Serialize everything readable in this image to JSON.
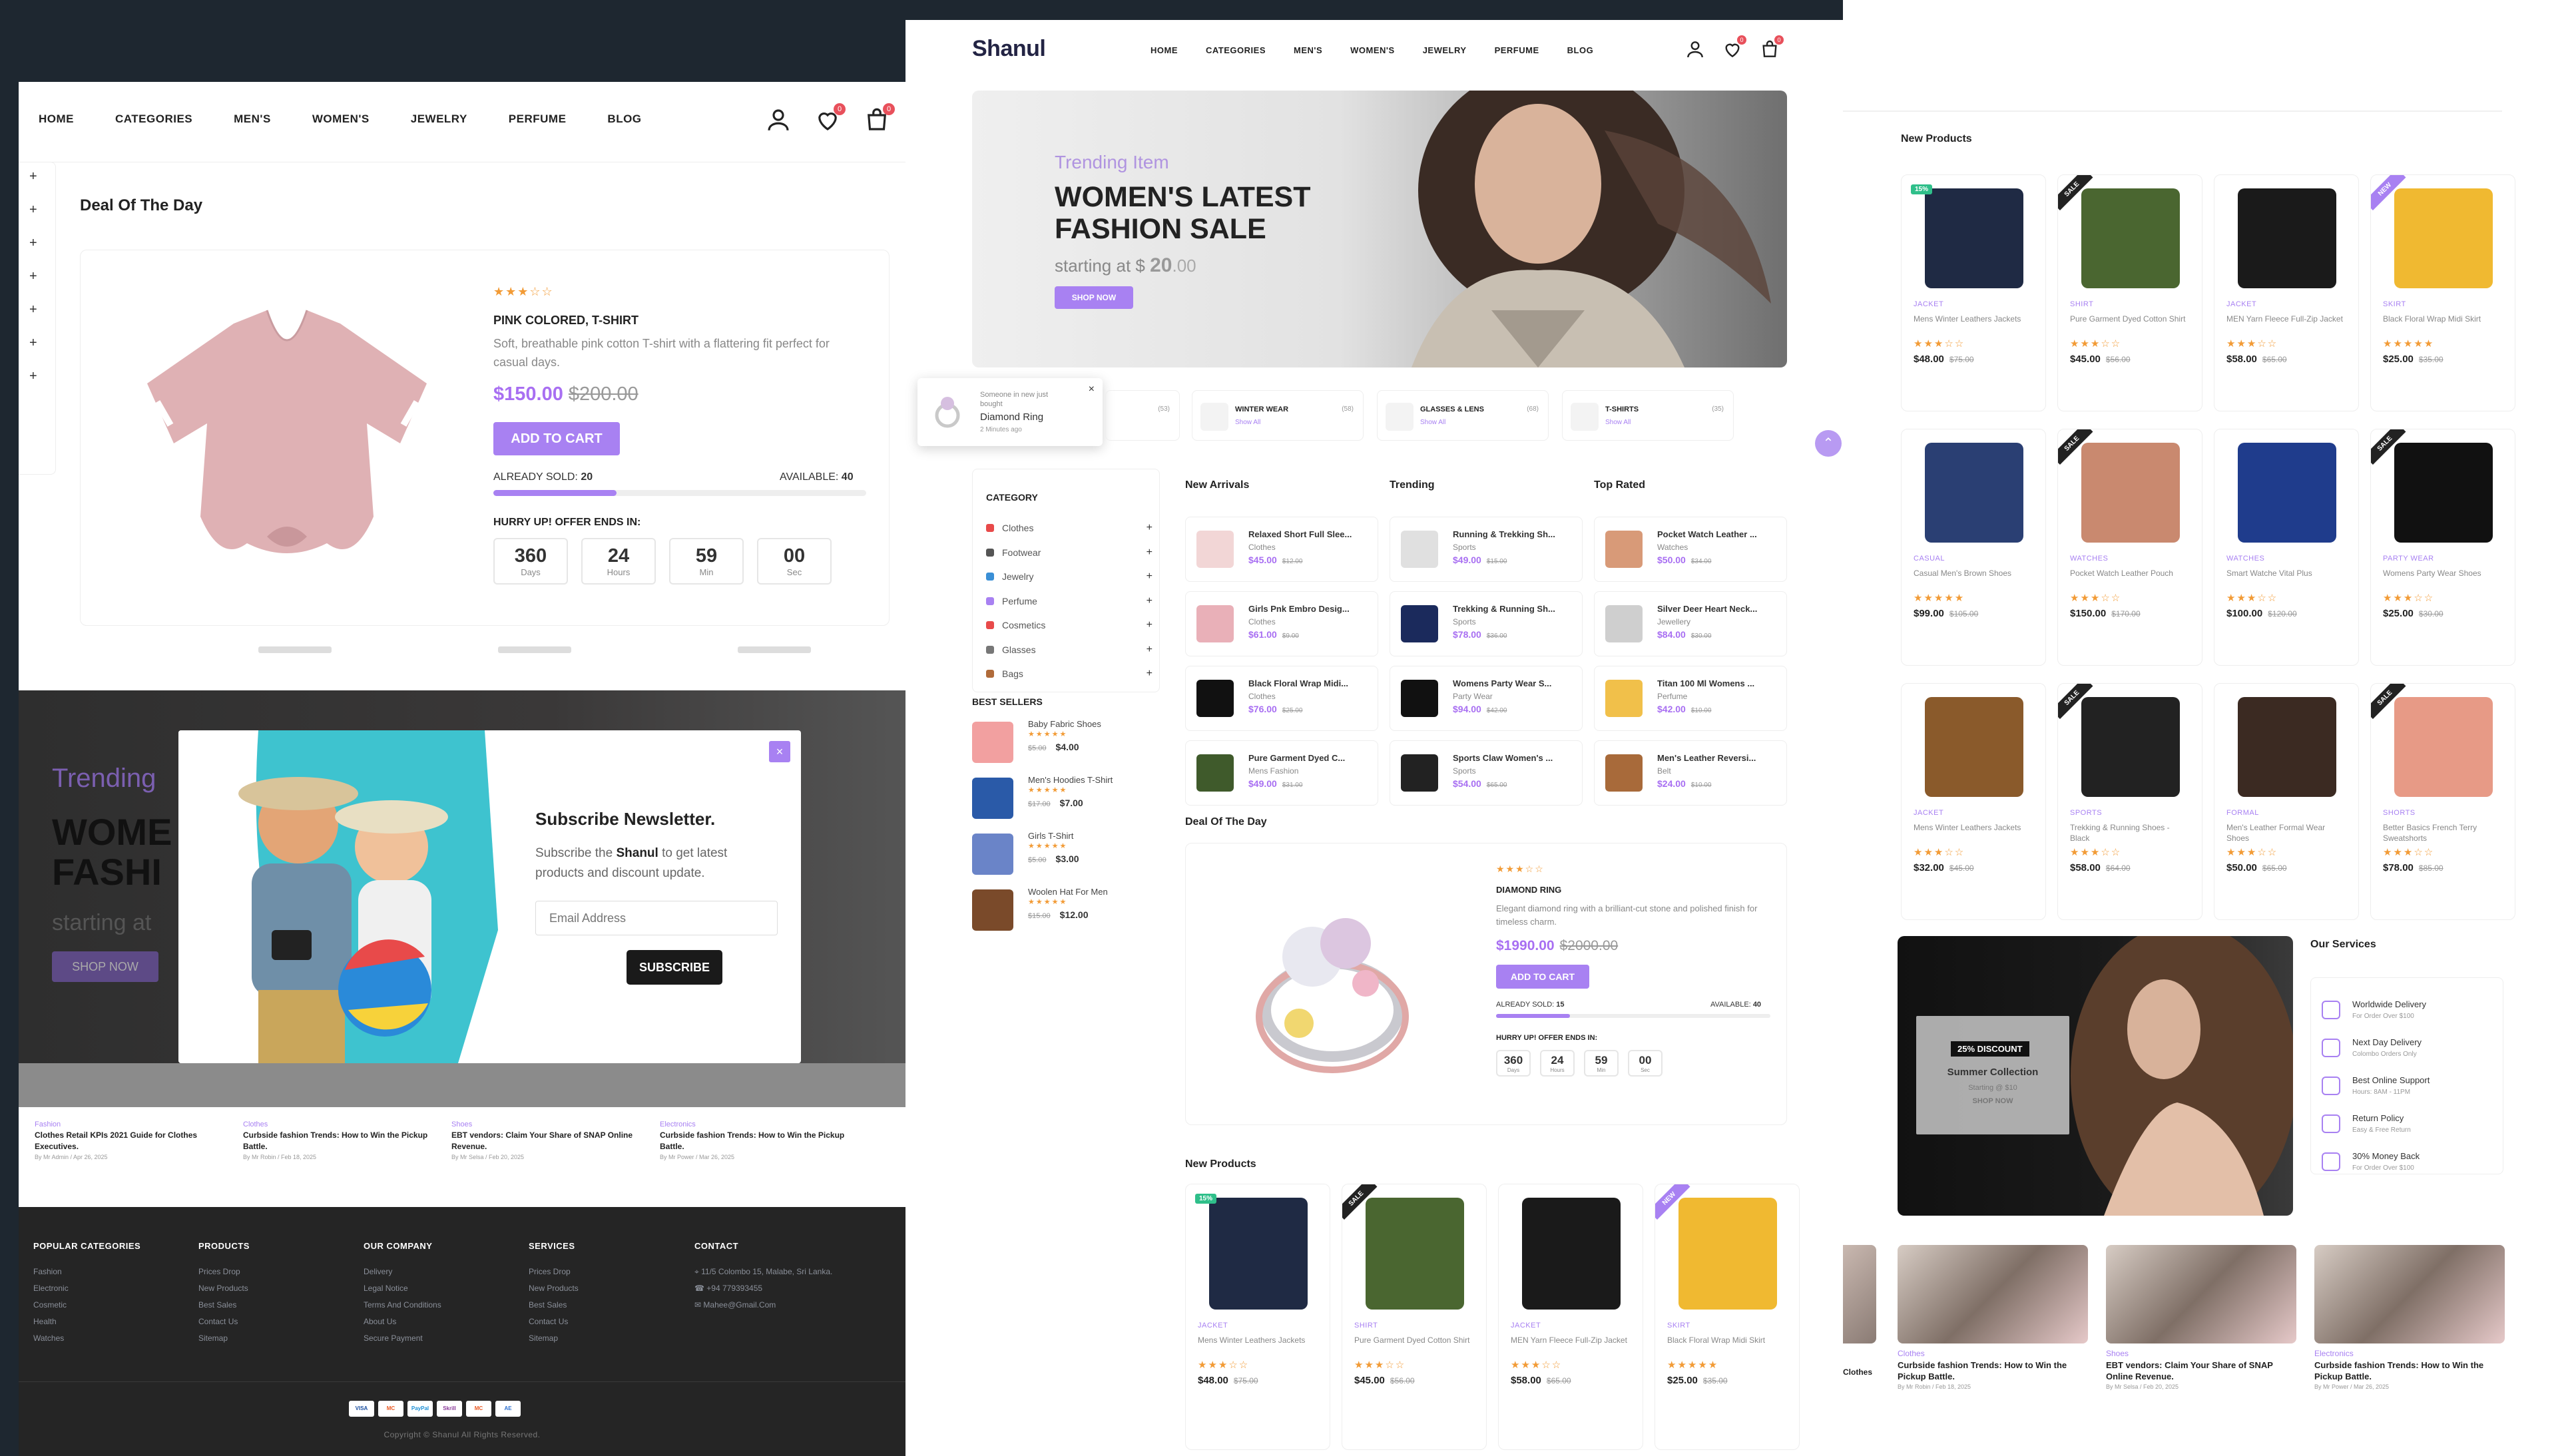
{
  "brand": "Shanul",
  "nav": [
    "HOME",
    "CATEGORIES",
    "MEN'S",
    "WOMEN'S",
    "JEWELRY",
    "PERFUME",
    "BLOG"
  ],
  "cart_count": "0",
  "wish_count": "0",
  "colors": {
    "accent": "#a881f2",
    "star": "#f29b36",
    "dark": "#1e2730",
    "footer": "#252525"
  },
  "icons": [
    "user-icon",
    "heart-icon",
    "cart-icon",
    "plus-icon",
    "close-icon",
    "chevron-up-icon"
  ],
  "deal": {
    "title": "Deal Of The Day",
    "name": "PINK COLORED, T-SHIRT",
    "desc": "Soft, breathable pink cotton T-shirt with a flattering fit perfect for casual days.",
    "price": "$150.00",
    "old": "$200.00",
    "stars": "★★★☆☆",
    "btn": "ADD TO CART",
    "sold_label": "ALREADY SOLD:",
    "sold": "20",
    "avail_label": "AVAILABLE:",
    "avail": "40",
    "sold_fraction": 0.33,
    "hurry": "HURRY UP! OFFER ENDS IN:",
    "count": [
      {
        "n": "360",
        "l": "Days"
      },
      {
        "n": "24",
        "l": "Hours"
      },
      {
        "n": "59",
        "l": "Min"
      },
      {
        "n": "00",
        "l": "Sec"
      }
    ]
  },
  "deal2": {
    "name": "DIAMOND RING",
    "desc": "Elegant diamond ring with a brilliant-cut stone and polished finish for timeless charm.",
    "price": "$1990.00",
    "old": "$2000.00",
    "stars": "★★★☆☆",
    "btn": "ADD TO CART",
    "sold": "15",
    "avail": "40",
    "sold_fraction": 0.27
  },
  "hero": {
    "kicker": "Trending Item",
    "title1": "WOMEN'S LATEST",
    "title2": "FASHION SALE",
    "sub": "starting at $",
    "price": "20",
    "price_suffix": ".00",
    "btn": "SHOP NOW"
  },
  "hero_left": {
    "kicker": "Trending",
    "t1": "WOME",
    "t2": "FASHI",
    "sub": "starting at",
    "btn": "SHOP NOW"
  },
  "newsletter": {
    "title": "Subscribe Newsletter.",
    "line1a": "Subscribe the ",
    "brand": "Shanul",
    "line1b": " to get latest",
    "line2": "products and discount update.",
    "placeholder": "Email Address",
    "btn": "SUBSCRIBE"
  },
  "toast": {
    "line1": "Someone in new just",
    "line2": "bought",
    "product": "Diamond Ring",
    "time": "2 Minutes ago"
  },
  "catstrip": [
    {
      "name": "",
      "count": "(53)"
    },
    {
      "name": "WINTER WEAR",
      "count": "(58)",
      "link": "Show All"
    },
    {
      "name": "GLASSES & LENS",
      "count": "(68)",
      "link": "Show All"
    },
    {
      "name": "T-SHIRTS",
      "count": "(35)",
      "link": "Show All"
    }
  ],
  "category": {
    "title": "CATEGORY",
    "items": [
      "Clothes",
      "Footwear",
      "Jewelry",
      "Perfume",
      "Cosmetics",
      "Glasses",
      "Bags"
    ]
  },
  "bestsellers": {
    "title": "BEST SELLERS",
    "items": [
      {
        "name": "Baby Fabric Shoes",
        "old": "$5.00",
        "price": "$4.00"
      },
      {
        "name": "Men's Hoodies T-Shirt",
        "old": "$17.00",
        "price": "$7.00"
      },
      {
        "name": "Girls T-Shirt",
        "old": "$5.00",
        "price": "$3.00"
      },
      {
        "name": "Woolen Hat For Men",
        "old": "$15.00",
        "price": "$12.00"
      }
    ]
  },
  "columns": [
    {
      "title": "New Arrivals",
      "items": [
        {
          "name": "Relaxed Short Full Slee...",
          "cat": "Clothes",
          "price": "$45.00",
          "old": "$12.00"
        },
        {
          "name": "Girls Pnk Embro Desig...",
          "cat": "Clothes",
          "price": "$61.00",
          "old": "$9.00"
        },
        {
          "name": "Black Floral Wrap Midi...",
          "cat": "Clothes",
          "price": "$76.00",
          "old": "$25.00"
        },
        {
          "name": "Pure Garment Dyed C...",
          "cat": "Mens Fashion",
          "price": "$49.00",
          "old": "$31.00"
        }
      ]
    },
    {
      "title": "Trending",
      "items": [
        {
          "name": "Running & Trekking Sh...",
          "cat": "Sports",
          "price": "$49.00",
          "old": "$15.00"
        },
        {
          "name": "Trekking & Running Sh...",
          "cat": "Sports",
          "price": "$78.00",
          "old": "$36.00"
        },
        {
          "name": "Womens Party Wear S...",
          "cat": "Party Wear",
          "price": "$94.00",
          "old": "$42.00"
        },
        {
          "name": "Sports Claw Women's ...",
          "cat": "Sports",
          "price": "$54.00",
          "old": "$65.00"
        }
      ]
    },
    {
      "title": "Top Rated",
      "items": [
        {
          "name": "Pocket Watch Leather ...",
          "cat": "Watches",
          "price": "$50.00",
          "old": "$34.00"
        },
        {
          "name": "Silver Deer Heart Neck...",
          "cat": "Jewellery",
          "price": "$84.00",
          "old": "$30.00"
        },
        {
          "name": "Titan 100 Ml Womens ...",
          "cat": "Perfume",
          "price": "$42.00",
          "old": "$10.00"
        },
        {
          "name": "Men's Leather Reversi...",
          "cat": "Belt",
          "price": "$24.00",
          "old": "$10.00"
        }
      ]
    }
  ],
  "new_products_title": "New Products",
  "products": [
    {
      "cat": "JACKET",
      "name": "Mens Winter Leathers Jackets",
      "stars": "★★★☆☆",
      "price": "$48.00",
      "old": "$75.00",
      "badge": "15%",
      "color": "#1f2a44"
    },
    {
      "cat": "SHIRT",
      "name": "Pure Garment Dyed Cotton Shirt",
      "stars": "★★★☆☆",
      "price": "$45.00",
      "old": "$56.00",
      "badge": "SALE",
      "color": "#4a6630"
    },
    {
      "cat": "JACKET",
      "name": "MEN Yarn Fleece Full-Zip Jacket",
      "stars": "★★★☆☆",
      "price": "$58.00",
      "old": "$65.00",
      "badge": "",
      "color": "#1a1a1a"
    },
    {
      "cat": "SKIRT",
      "name": "Black Floral Wrap Midi Skirt",
      "stars": "★★★★★",
      "price": "$25.00",
      "old": "$35.00",
      "badge": "NEW",
      "color": "#f0b931"
    },
    {
      "cat": "CASUAL",
      "name": "Casual Men's Brown Shoes",
      "stars": "★★★★★",
      "price": "$99.00",
      "old": "$105.00",
      "badge": "",
      "color": "#2a3f73"
    },
    {
      "cat": "WATCHES",
      "name": "Pocket Watch Leather Pouch",
      "stars": "★★★☆☆",
      "price": "$150.00",
      "old": "$170.00",
      "badge": "SALE",
      "color": "#c9896f"
    },
    {
      "cat": "WATCHES",
      "name": "Smart Watche Vital Plus",
      "stars": "★★★☆☆",
      "price": "$100.00",
      "old": "$120.00",
      "badge": "",
      "color": "#1f3c8c"
    },
    {
      "cat": "PARTY WEAR",
      "name": "Womens Party Wear Shoes",
      "stars": "★★★☆☆",
      "price": "$25.00",
      "old": "$30.00",
      "badge": "SALE",
      "color": "#111111"
    },
    {
      "cat": "JACKET",
      "name": "Mens Winter Leathers Jackets",
      "stars": "★★★☆☆",
      "price": "$32.00",
      "old": "$45.00",
      "badge": "",
      "color": "#8a5a2b"
    },
    {
      "cat": "SPORTS",
      "name": "Trekking & Running Shoes - Black",
      "stars": "★★★☆☆",
      "price": "$58.00",
      "old": "$64.00",
      "badge": "SALE",
      "color": "#222222"
    },
    {
      "cat": "FORMAL",
      "name": "Men's Leather Formal Wear Shoes",
      "stars": "★★★☆☆",
      "price": "$50.00",
      "old": "$65.00",
      "badge": "",
      "color": "#3b2a22"
    },
    {
      "cat": "SHORTS",
      "name": "Better Basics French Terry Sweatshorts",
      "stars": "★★★☆☆",
      "price": "$78.00",
      "old": "$85.00",
      "badge": "SALE",
      "color": "#e79a86"
    }
  ],
  "services": {
    "title": "Our Services",
    "items": [
      {
        "t": "Worldwide Delivery",
        "s": "For Order Over $100"
      },
      {
        "t": "Next Day Delivery",
        "s": "Colombo Orders Only"
      },
      {
        "t": "Best Online Support",
        "s": "Hours: 8AM - 11PM"
      },
      {
        "t": "Return Policy",
        "s": "Easy & Free Return"
      },
      {
        "t": "30% Money Back",
        "s": "For Order Over $100"
      }
    ]
  },
  "promo": {
    "badge": "25% DISCOUNT",
    "title": "Summer Collection",
    "sub": "Starting @ $10",
    "btn": "SHOP NOW"
  },
  "blogs": [
    {
      "cat": "Fashion",
      "title": "Clothes Retail KPIs 2021 Guide for Clothes Executives.",
      "meta": "By Mr Admin / Apr 26, 2025"
    },
    {
      "cat": "Clothes",
      "title": "Curbside fashion Trends: How to Win the Pickup Battle.",
      "meta": "By Mr Robin / Feb 18, 2025"
    },
    {
      "cat": "Shoes",
      "title": "EBT vendors: Claim Your Share of SNAP Online Revenue.",
      "meta": "By Mr Selsa / Feb 20, 2025"
    },
    {
      "cat": "Electronics",
      "title": "Curbside fashion Trends: How to Win the Pickup Battle.",
      "meta": "By Mr Power / Mar 26, 2025"
    }
  ],
  "blog_right_partial": "Clothes",
  "footer": {
    "cols": [
      {
        "title": "POPULAR CATEGORIES",
        "items": [
          "Fashion",
          "Electronic",
          "Cosmetic",
          "Health",
          "Watches"
        ]
      },
      {
        "title": "PRODUCTS",
        "items": [
          "Prices Drop",
          "New Products",
          "Best Sales",
          "Contact Us",
          "Sitemap"
        ]
      },
      {
        "title": "OUR COMPANY",
        "items": [
          "Delivery",
          "Legal Notice",
          "Terms And Conditions",
          "About Us",
          "Secure Payment"
        ]
      },
      {
        "title": "SERVICES",
        "items": [
          "Prices Drop",
          "New Products",
          "Best Sales",
          "Contact Us",
          "Sitemap"
        ]
      }
    ],
    "contact_title": "CONTACT",
    "address": "11/5 Colombo 15, Malabe, Sri Lanka.",
    "phone": "+94 779393455",
    "email": "Mahee@Gmail.Com",
    "payments": [
      "VISA",
      "MC",
      "PayPal",
      "Skrill",
      "MC",
      "AE"
    ],
    "copyright": "Copyright © Shanul All Rights Reserved."
  }
}
